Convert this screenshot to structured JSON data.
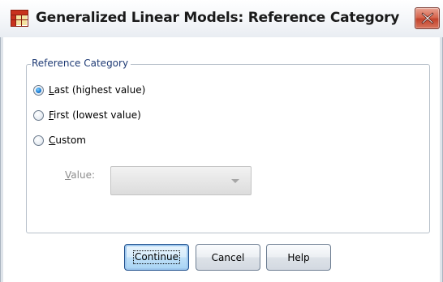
{
  "window": {
    "title": "Generalized Linear Models: Reference Category",
    "icon": "spss-grid-icon",
    "close_icon": "close-x-icon"
  },
  "group": {
    "legend": "Reference Category"
  },
  "options": [
    {
      "key": "L",
      "rest": "ast (highest value)",
      "checked": true
    },
    {
      "key": "F",
      "rest": "irst (lowest value)",
      "checked": false
    },
    {
      "key": "C",
      "rest": "ustom",
      "checked": false
    }
  ],
  "value_field": {
    "label_key": "V",
    "label_rest": "alue:",
    "selected": "",
    "enabled": false
  },
  "buttons": {
    "continue": "Continue",
    "cancel": "Cancel",
    "help": "Help"
  },
  "colors": {
    "legend_text": "#1f3b75",
    "close_button": "#d7674f",
    "radio_selected": "#1f7fd6",
    "disabled_text": "#8d8d8d"
  }
}
